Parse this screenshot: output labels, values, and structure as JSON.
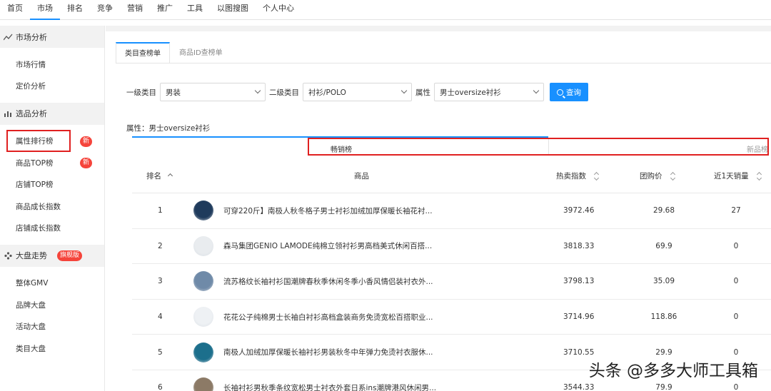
{
  "topnav": [
    "首页",
    "市场",
    "排名",
    "竞争",
    "营销",
    "推广",
    "工具",
    "以图搜图",
    "个人中心"
  ],
  "sidebar": {
    "group1": "市场分析",
    "g1_items": [
      "市场行情",
      "定价分析"
    ],
    "group2": "选品分析",
    "g2_items": [
      "属性排行榜",
      "商品TOP榜",
      "店铺TOP榜",
      "商品成长指数",
      "店铺成长指数"
    ],
    "new_badge": "新",
    "group3": "大盘走势",
    "flagship_badge": "旗舰版",
    "g3_items": [
      "整体GMV",
      "品牌大盘",
      "活动大盘",
      "类目大盘"
    ]
  },
  "tabs": [
    "类目查榜单",
    "商品ID查榜单"
  ],
  "filters": {
    "level1_label": "一级类目",
    "level1_value": "男装",
    "level2_label": "二级类目",
    "level2_value": "衬衫/POLO",
    "attr_label": "属性",
    "attr_value": "男士oversize衬衫",
    "query_button": "查询"
  },
  "attr_line": "属性：男士oversize衬衫",
  "board": {
    "hot": "畅销榜",
    "new": "新品榜"
  },
  "table": {
    "headers": {
      "rank": "排名",
      "product": "商品",
      "hot_index": "热卖指数",
      "group_price": "团购价",
      "sales_1d": "近1天销量"
    },
    "rows": [
      {
        "rank": "1",
        "title": "可穿220斤】南极人秋冬格子男士衬衫加绒加厚保暖长袖花衬...",
        "hot_index": "3972.46",
        "price": "29.68",
        "sales": "27",
        "thumb_color": "#1f3b5c"
      },
      {
        "rank": "2",
        "title": "森马集团GENIO LAMODE纯棉立领衬衫男高档美式休闲百搭...",
        "hot_index": "3818.33",
        "price": "69.9",
        "sales": "0",
        "thumb_color": "#e9ecef"
      },
      {
        "rank": "3",
        "title": "流苏格纹长袖衬衫国潮牌春秋季休闲冬季小香风情侣装衬衣外...",
        "hot_index": "3798.13",
        "price": "35.09",
        "sales": "0",
        "thumb_color": "#6f8aa8"
      },
      {
        "rank": "4",
        "title": "花花公子纯棉男士长袖白衬衫高档盒装商务免烫宽松百搭职业...",
        "hot_index": "3714.96",
        "price": "118.86",
        "sales": "0",
        "thumb_color": "#eef1f4"
      },
      {
        "rank": "5",
        "title": "南极人加绒加厚保暖长袖衬衫男装秋冬中年弹力免烫衬衣服休...",
        "hot_index": "3710.55",
        "price": "29.9",
        "sales": "0",
        "thumb_color": "#1c6f8c"
      },
      {
        "rank": "6",
        "title": "长袖衬衫男秋季条纹宽松男士衬衣外套日系ins潮牌港风休闲男...",
        "hot_index": "3544.33",
        "price": "79.9",
        "sales": "0",
        "thumb_color": "#8c7a66"
      }
    ]
  },
  "watermark": "头条 @多多大师工具箱"
}
